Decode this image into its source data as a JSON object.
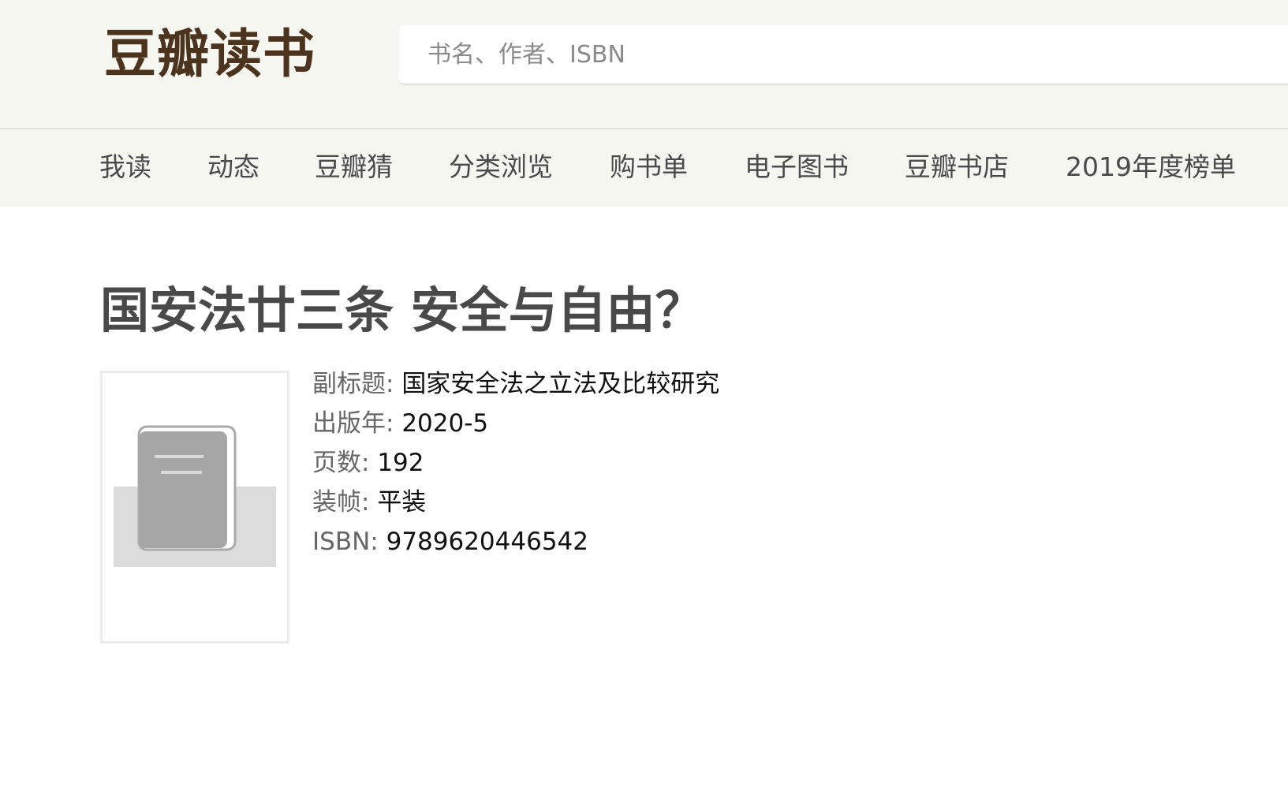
{
  "header": {
    "logo": "豆瓣读书",
    "search_placeholder": "书名、作者、ISBN",
    "search_value": ""
  },
  "nav": {
    "items": [
      {
        "label": "我读"
      },
      {
        "label": "动态"
      },
      {
        "label": "豆瓣猜"
      },
      {
        "label": "分类浏览"
      },
      {
        "label": "购书单"
      },
      {
        "label": "电子图书"
      },
      {
        "label": "豆瓣书店"
      },
      {
        "label": "2019年度榜单"
      }
    ]
  },
  "book": {
    "title": "国安法廿三条 安全与自由？",
    "cover_icon": "book-placeholder-icon",
    "info": {
      "subtitle": {
        "label": "副标题:",
        "value": "国家安全法之立法及比较研究"
      },
      "year": {
        "label": "出版年:",
        "value": "2020-5"
      },
      "pages": {
        "label": "页数:",
        "value": "192"
      },
      "binding": {
        "label": "装帧:",
        "value": "平装"
      },
      "isbn": {
        "label": "ISBN:",
        "value": "9789620446542"
      }
    }
  },
  "colors": {
    "header_bg": "#f6f6f1",
    "logo": "#4b331d",
    "title": "#494949",
    "label": "#666666"
  }
}
